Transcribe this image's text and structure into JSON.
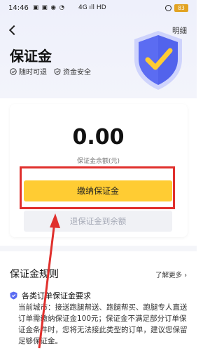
{
  "status_bar": {
    "time": "14:46",
    "icons": "▣ ▣ ◉ ◔",
    "network": "4G ıll HD",
    "battery": "83"
  },
  "header": {
    "detail_label": "明细",
    "title": "保证金",
    "features": [
      {
        "label": "随时可退",
        "icon": "clock-check-icon"
      },
      {
        "label": "资金安全",
        "icon": "shield-check-icon"
      }
    ]
  },
  "balance": {
    "amount": "0.00",
    "label": "保证金余额(元)"
  },
  "actions": {
    "pay_label": "缴纳保证金",
    "refund_label": "退保证金到余额"
  },
  "rules": {
    "title": "保证金规则",
    "more_label": "了解更多 ›",
    "item_title": "各类订单保证金要求",
    "item_text": "当前城市：接送跑腿帮送、跑腿帮买、跑腿专人直送订单需缴纳保证金100元；保证金不满足部分订单保证金条件时，您将无法接此类型的订单，建议您保留足够保证金。"
  },
  "colors": {
    "accent_yellow": "#ffcc33",
    "annotation_red": "#e0302d",
    "shield_blue": "#5b6cf2"
  }
}
